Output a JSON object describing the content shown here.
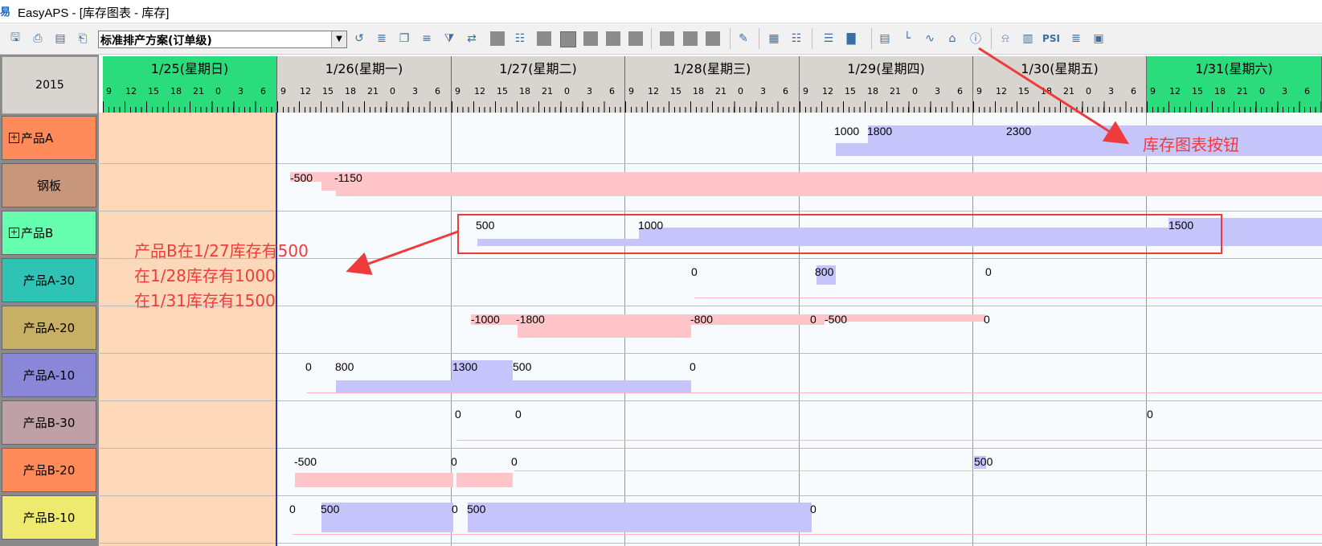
{
  "window": {
    "title": "EasyAPS - [库存图表 - 库存]",
    "logo_icon": "easyaps-logo-icon"
  },
  "toolbar": {
    "plan_select_value": "标准排产方案(订单级)",
    "icons": [
      "save-icon",
      "print-icon",
      "print-preview-icon",
      "printer-icon",
      "refresh-icon",
      "settings-icon",
      "copy-icon",
      "list-icon",
      "filter-icon",
      "sort-icon",
      "calendar-icon",
      "tree-icon",
      "edit-icon",
      "chart-grid-icon",
      "grid-icon",
      "align-left-icon",
      "bar-chart-icon",
      "table-icon",
      "axis-chart-icon",
      "line-chart-icon",
      "home-icon",
      "info-icon",
      "bell-icon",
      "form-icon",
      "psi-icon",
      "report-icon",
      "image-icon"
    ],
    "psi_label": "PSI"
  },
  "gantt": {
    "year": "2015",
    "days": [
      {
        "label": "1/25(星期日)",
        "bg": "#2bdc7c"
      },
      {
        "label": "1/26(星期一)",
        "bg": "#d8d4cf"
      },
      {
        "label": "1/27(星期二)",
        "bg": "#d8d4cf"
      },
      {
        "label": "1/28(星期三)",
        "bg": "#d8d4cf"
      },
      {
        "label": "1/29(星期四)",
        "bg": "#d8d4cf"
      },
      {
        "label": "1/30(星期五)",
        "bg": "#d8d4cf"
      },
      {
        "label": "1/31(星期六)",
        "bg": "#2bdc7c"
      }
    ],
    "hours": [
      "9",
      "12",
      "15",
      "18",
      "21",
      "0",
      "3",
      "6"
    ],
    "rows": [
      {
        "label": "产品A",
        "expandable": true,
        "color": "#ff8a5a"
      },
      {
        "label": "钢板",
        "expandable": false,
        "color": "#c8967a"
      },
      {
        "label": "产品B",
        "expandable": true,
        "color": "#66ffb0"
      },
      {
        "label": "产品A-30",
        "expandable": false,
        "color": "#2ec3b5"
      },
      {
        "label": "产品A-20",
        "expandable": false,
        "color": "#c8af66"
      },
      {
        "label": "产品A-10",
        "expandable": false,
        "color": "#8a86d8"
      },
      {
        "label": "产品B-30",
        "expandable": false,
        "color": "#bfa0a8"
      },
      {
        "label": "产品B-20",
        "expandable": false,
        "color": "#ff8a5a"
      },
      {
        "label": "产品B-10",
        "expandable": false,
        "color": "#eeea70"
      }
    ],
    "values": {
      "r0": [
        "1000",
        "1800",
        "2300"
      ],
      "r1": [
        "-500",
        "-1150"
      ],
      "r2": [
        "500",
        "1000",
        "1500"
      ],
      "r3": [
        "0",
        "800",
        "0"
      ],
      "r4": [
        "-1000",
        "-1800",
        "-800",
        "0",
        "-500",
        "0"
      ],
      "r5": [
        "0",
        "800",
        "1300",
        "500",
        "0"
      ],
      "r6": [
        "0",
        "0",
        "0"
      ],
      "r7": [
        "-500",
        "0",
        "0",
        "500"
      ],
      "r8": [
        "0",
        "500",
        "0",
        "500",
        "0"
      ]
    }
  },
  "annotations": {
    "button_note": "库存图表按钮",
    "lines": [
      "产品B在1/27库存有500",
      "在1/28库存有1000",
      "在1/31库存有1500"
    ],
    "color": "#ef3b3b"
  }
}
